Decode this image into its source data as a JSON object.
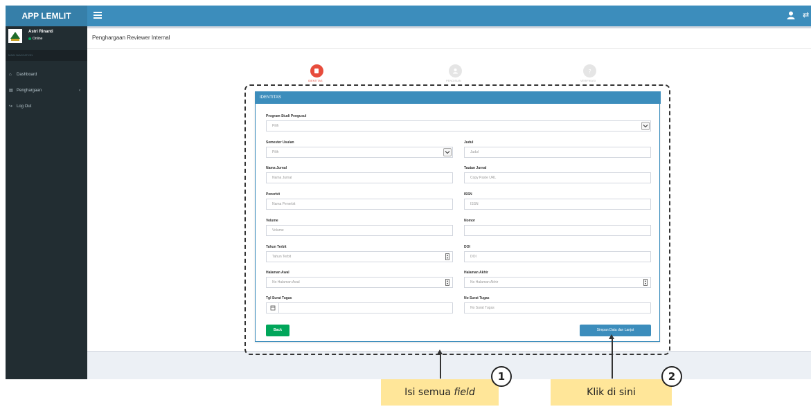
{
  "app": {
    "brand": "APP LEMLIT"
  },
  "user": {
    "name": "Astri Rinanti",
    "status": "Online"
  },
  "sidebar": {
    "header": "MAIN NAVIGATION",
    "items": [
      {
        "label": "Dashboard",
        "icon": "home-icon"
      },
      {
        "label": "Penghargaan",
        "icon": "book-icon",
        "chevron": "‹"
      },
      {
        "label": "Log Out",
        "icon": "logout-icon"
      }
    ]
  },
  "page": {
    "title": "Penghargaan Reviewer Internal"
  },
  "stepper": {
    "steps": [
      {
        "label": "IDENTITAS",
        "active": true
      },
      {
        "label": "PENGISIAN",
        "active": false
      },
      {
        "label": "VERIFIKASI",
        "active": false
      }
    ]
  },
  "form": {
    "header": "IDENTITAS",
    "program_studi": {
      "label": "Program Studi Pengusul",
      "value": "Pilih"
    },
    "semester": {
      "label": "Semester Usulan",
      "value": "Pilih"
    },
    "judul": {
      "label": "Judul",
      "placeholder": "Judul"
    },
    "nama_jurnal": {
      "label": "Nama Jurnal",
      "placeholder": "Nama Jurnal"
    },
    "tautan_jurnal": {
      "label": "Tautan Jurnal",
      "placeholder": "Copy Paste URL"
    },
    "penerbit": {
      "label": "Penerbit",
      "placeholder": "Nama Penerbit"
    },
    "issn": {
      "label": "ISSN",
      "placeholder": "ISSN"
    },
    "volume": {
      "label": "Volume",
      "placeholder": "Volume"
    },
    "nomor": {
      "label": "Nomor",
      "placeholder": ""
    },
    "tahun_terbit": {
      "label": "Tahun Terbit",
      "placeholder": "Tahun Terbit"
    },
    "doi": {
      "label": "DOI",
      "placeholder": "DOI"
    },
    "halaman_awal": {
      "label": "Halaman Awal",
      "placeholder": "No Halaman Awal"
    },
    "halaman_akhir": {
      "label": "Halaman Akhir",
      "placeholder": "No Halaman Akhir"
    },
    "tgl_surat": {
      "label": "Tgl Surat Tugas",
      "placeholder": ""
    },
    "no_surat": {
      "label": "No Surat Tugas",
      "placeholder": "No Surat Tugas"
    },
    "back_label": "Back",
    "save_label": "Simpan Data dan Lanjut"
  },
  "annotations": {
    "note1": {
      "number": "1",
      "text_plain": "Isi semua ",
      "text_italic": "field"
    },
    "note2": {
      "number": "2",
      "text": "Klik di sini"
    }
  },
  "colors": {
    "topbar": "#3c8dbc",
    "sidebar": "#222d32",
    "accent": "#3c8dbc",
    "step_active": "#e74c3c",
    "back_button": "#00a65a",
    "note_bg": "#ffe699"
  }
}
